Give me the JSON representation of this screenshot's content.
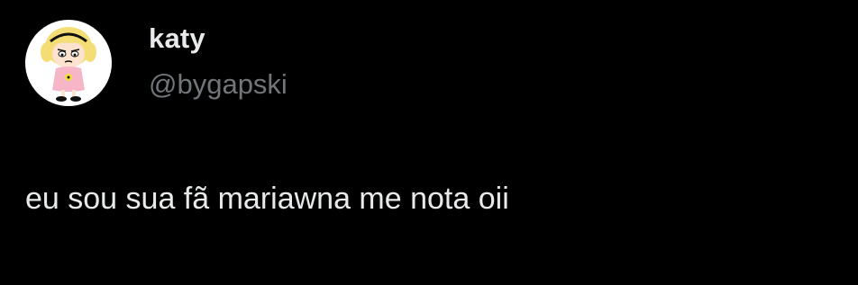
{
  "user": {
    "display_name": "katy",
    "handle": "@bygapski",
    "avatar_icon": "cartoon-girl-avatar"
  },
  "tweet": {
    "text": "eu sou sua fã mariawna me nota oii"
  },
  "colors": {
    "background": "#000000",
    "primary_text": "#e7e9ea",
    "secondary_text": "#71767b"
  }
}
